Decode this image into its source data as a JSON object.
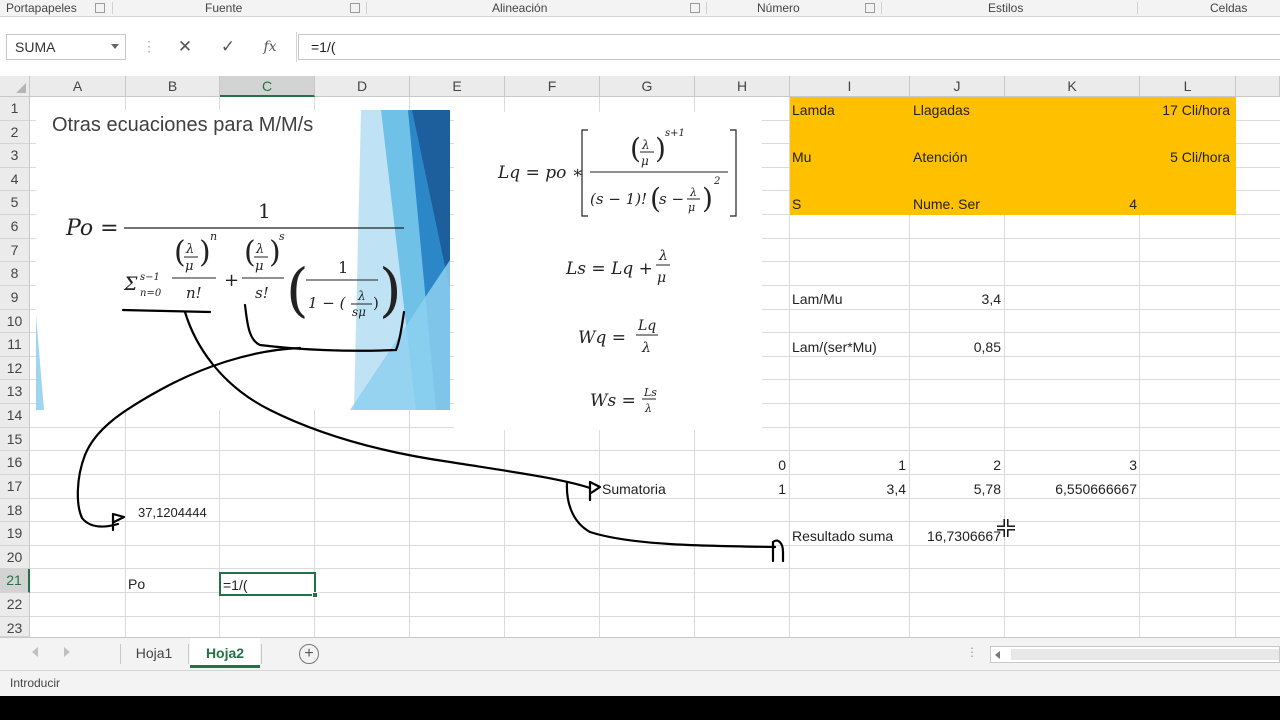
{
  "ribbon": {
    "groups": [
      "Portapapeles",
      "Fuente",
      "Alineación",
      "Número",
      "Estilos",
      "Celdas"
    ]
  },
  "formula_bar": {
    "name_box": "SUMA",
    "cancel_icon": "✕",
    "enter_icon": "✓",
    "fx_label": "fx",
    "formula": "=1/("
  },
  "grid": {
    "columns": [
      "A",
      "B",
      "C",
      "D",
      "E",
      "F",
      "G",
      "H",
      "I",
      "J",
      "K",
      "L"
    ],
    "selected_column": "C",
    "rows": [
      "1",
      "2",
      "3",
      "4",
      "5",
      "6",
      "7",
      "8",
      "9",
      "10",
      "11",
      "12",
      "13",
      "14",
      "15",
      "16",
      "17",
      "18",
      "19",
      "20",
      "21",
      "22",
      "23"
    ],
    "selected_row": "21"
  },
  "cells": {
    "I1": "Lamda",
    "J1": "Llagadas",
    "K1": "17 Cli/hora",
    "I3": "Mu",
    "J3": "Atención",
    "K3": "5 Cli/hora",
    "I5": "S",
    "J5": "Nume. Ser",
    "K5": "4",
    "I9": "Lam/Mu",
    "J9": "3,4",
    "I11": "Lam/(ser*Mu)",
    "J11": "0,85",
    "H16": "0",
    "I16": "1",
    "J16": "2",
    "K16": "3",
    "G17": "Sumatoria",
    "H17": "1",
    "I17": "3,4",
    "J17": "5,78",
    "K17": "6,550666667",
    "B18": "37,1204444",
    "I19": "Resultado suma",
    "J19": "16,7306667",
    "B21": "Po",
    "C21": "=1/("
  },
  "image_left": {
    "title": "Otras ecuaciones para M/M/s"
  },
  "sheets": {
    "tabs": [
      "Hoja1",
      "Hoja2"
    ],
    "active": "Hoja2",
    "add_icon": "+"
  },
  "status": {
    "mode": "Introducir"
  },
  "colors": {
    "excel_green": "#217346",
    "highlight": "#ffc000",
    "ink": "#000000"
  }
}
